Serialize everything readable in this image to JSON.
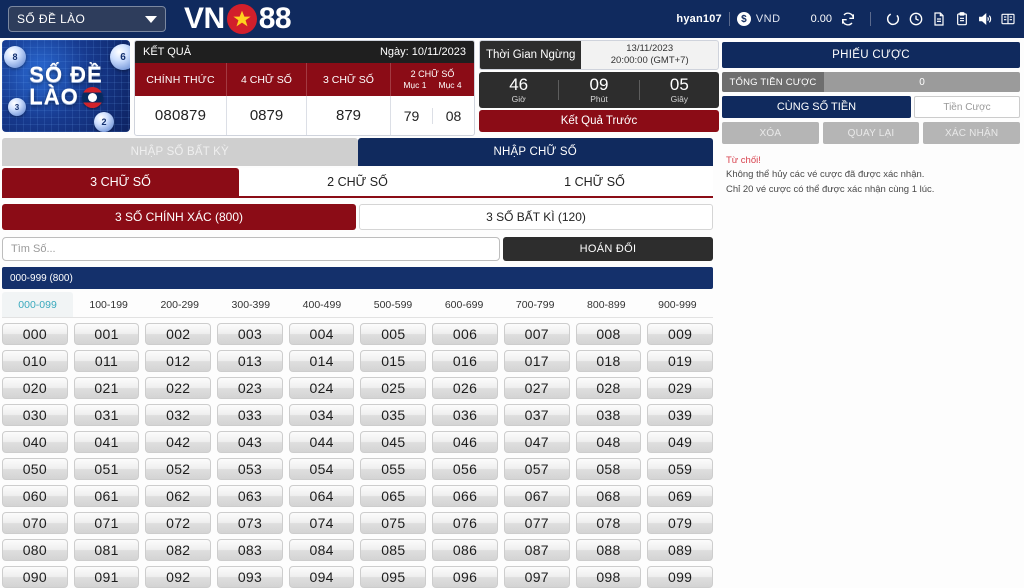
{
  "topbar": {
    "game_select": "SỐ ĐỀ LÀO",
    "brand_left": "VN",
    "brand_right": "88",
    "username": "hyan107",
    "currency": "VND",
    "coin_symbol": "$",
    "balance": "0.00",
    "icons": [
      "refresh-icon",
      "loading-circle-icon",
      "history-clock-icon",
      "document-icon",
      "clipboard-icon",
      "sound-icon",
      "book-icon"
    ]
  },
  "logo": {
    "line1": "SỐ ĐỀ",
    "line2": "LÀO",
    "balls": [
      "8",
      "3",
      "6",
      "2"
    ]
  },
  "result": {
    "title": "KẾT QUẢ",
    "date_label": "Ngày: 10/11/2023",
    "columns": [
      "CHÍNH THỨC",
      "4 CHỮ SỐ",
      "3 CHỮ SỐ"
    ],
    "col4_title": "2 CHỮ SỐ",
    "col4_subs": [
      "Mục 1",
      "Mục 4"
    ],
    "values": [
      "080879",
      "0879",
      "879"
    ],
    "col4_values": [
      "79",
      "08"
    ]
  },
  "timer": {
    "label": "Thời Gian Ngừng",
    "date": "13/11/2023",
    "time": "20:00:00 (GMT+7)",
    "segments": [
      {
        "value": "46",
        "label": "Giờ"
      },
      {
        "value": "09",
        "label": "Phút"
      },
      {
        "value": "05",
        "label": "Giây"
      }
    ],
    "prev_button": "Kết Quả Trước"
  },
  "betslip": {
    "title": "PHIẾU CƯỢC",
    "total_label": "TỔNG TIỀN CƯỢC",
    "total_value": "0",
    "same_amount_label": "CÙNG SỐ TIỀN",
    "amount_placeholder": "Tiền Cược",
    "actions": [
      "XÓA",
      "QUAY LẠI",
      "XÁC NHẬN"
    ],
    "warning_title": "Từ chối!",
    "warning_line1": "Không thể hủy các vé cược đã được xác nhận.",
    "warning_line2": "Chỉ 20 vé cược có thể được xác nhận cùng 1 lúc."
  },
  "tabs": {
    "entry": [
      {
        "label": "NHẬP SỐ BẤT KỲ",
        "active": false
      },
      {
        "label": "NHẬP CHỮ SỐ",
        "active": true
      }
    ],
    "digits": [
      {
        "label": "3 CHỮ SỐ",
        "active": true
      },
      {
        "label": "2 CHỮ SỐ",
        "active": false
      },
      {
        "label": "1 CHỮ SỐ",
        "active": false
      }
    ],
    "modes": [
      {
        "label": "3 SỐ CHÍNH XÁC (800)",
        "active": true
      },
      {
        "label": "3 SỐ BẤT KÌ (120)",
        "active": false
      }
    ]
  },
  "search": {
    "placeholder": "Tìm Số...",
    "value": "",
    "swap_label": "HOÁN ĐỔI"
  },
  "range_bar": "000-999 (800)",
  "subtabs": [
    {
      "label": "000-099",
      "active": true
    },
    {
      "label": "100-199",
      "active": false
    },
    {
      "label": "200-299",
      "active": false
    },
    {
      "label": "300-399",
      "active": false
    },
    {
      "label": "400-499",
      "active": false
    },
    {
      "label": "500-599",
      "active": false
    },
    {
      "label": "600-699",
      "active": false
    },
    {
      "label": "700-799",
      "active": false
    },
    {
      "label": "800-899",
      "active": false
    },
    {
      "label": "900-999",
      "active": false
    }
  ],
  "numbers": [
    "000",
    "001",
    "002",
    "003",
    "004",
    "005",
    "006",
    "007",
    "008",
    "009",
    "010",
    "011",
    "012",
    "013",
    "014",
    "015",
    "016",
    "017",
    "018",
    "019",
    "020",
    "021",
    "022",
    "023",
    "024",
    "025",
    "026",
    "027",
    "028",
    "029",
    "030",
    "031",
    "032",
    "033",
    "034",
    "035",
    "036",
    "037",
    "038",
    "039",
    "040",
    "041",
    "042",
    "043",
    "044",
    "045",
    "046",
    "047",
    "048",
    "049",
    "050",
    "051",
    "052",
    "053",
    "054",
    "055",
    "056",
    "057",
    "058",
    "059",
    "060",
    "061",
    "062",
    "063",
    "064",
    "065",
    "066",
    "067",
    "068",
    "069",
    "070",
    "071",
    "072",
    "073",
    "074",
    "075",
    "076",
    "077",
    "078",
    "079",
    "080",
    "081",
    "082",
    "083",
    "084",
    "085",
    "086",
    "087",
    "088",
    "089",
    "090",
    "091",
    "092",
    "093",
    "094",
    "095",
    "096",
    "097",
    "098",
    "099"
  ],
  "colors": {
    "navy": "#102a5e",
    "dark_red": "#8b0c16",
    "dark": "#2d2d2d",
    "accent_teal": "#3aa9bd",
    "reject_red": "#d8434f"
  }
}
